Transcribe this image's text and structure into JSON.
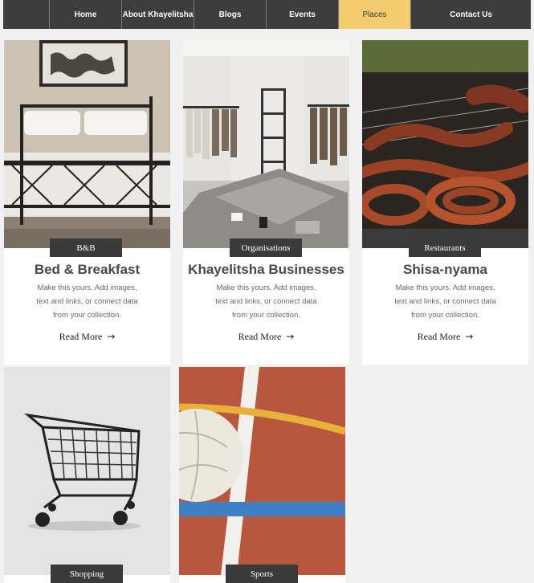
{
  "nav": {
    "items": [
      {
        "label": ""
      },
      {
        "label": "Home"
      },
      {
        "label": "About Khayelitsha"
      },
      {
        "label": "Blogs"
      },
      {
        "label": "Events"
      },
      {
        "label": "Places"
      },
      {
        "label": "Contact Us"
      }
    ],
    "active": "Places",
    "accent_color": "#f2cc6e",
    "bar_color": "#3d3d3d"
  },
  "cards": [
    {
      "tag": "B&B",
      "title": "Bed & Breakfast",
      "desc_lines": [
        "Make this yours. Add images,",
        "text and links, or connect data",
        "from your collection."
      ],
      "read_more": "Read More",
      "image": "bedroom-image"
    },
    {
      "tag": "Organisations",
      "title": "Khayelitsha Businesses",
      "desc_lines": [
        "Make this yours. Add images,",
        "text and links, or connect data",
        "from your collection."
      ],
      "read_more": "Read More",
      "image": "clothing-store-image"
    },
    {
      "tag": "Restaurants",
      "title": "Shisa-nyama",
      "desc_lines": [
        "Make this yours. Add images,",
        "text and links, or connect data",
        "from your collection."
      ],
      "read_more": "Read More",
      "image": "grilled-meat-image"
    },
    {
      "tag": "Shopping",
      "image": "shopping-cart-image"
    },
    {
      "tag": "Sports",
      "image": "volleyball-court-image"
    }
  ],
  "icons": {
    "read_more_arrow": "arrow-right-icon"
  }
}
